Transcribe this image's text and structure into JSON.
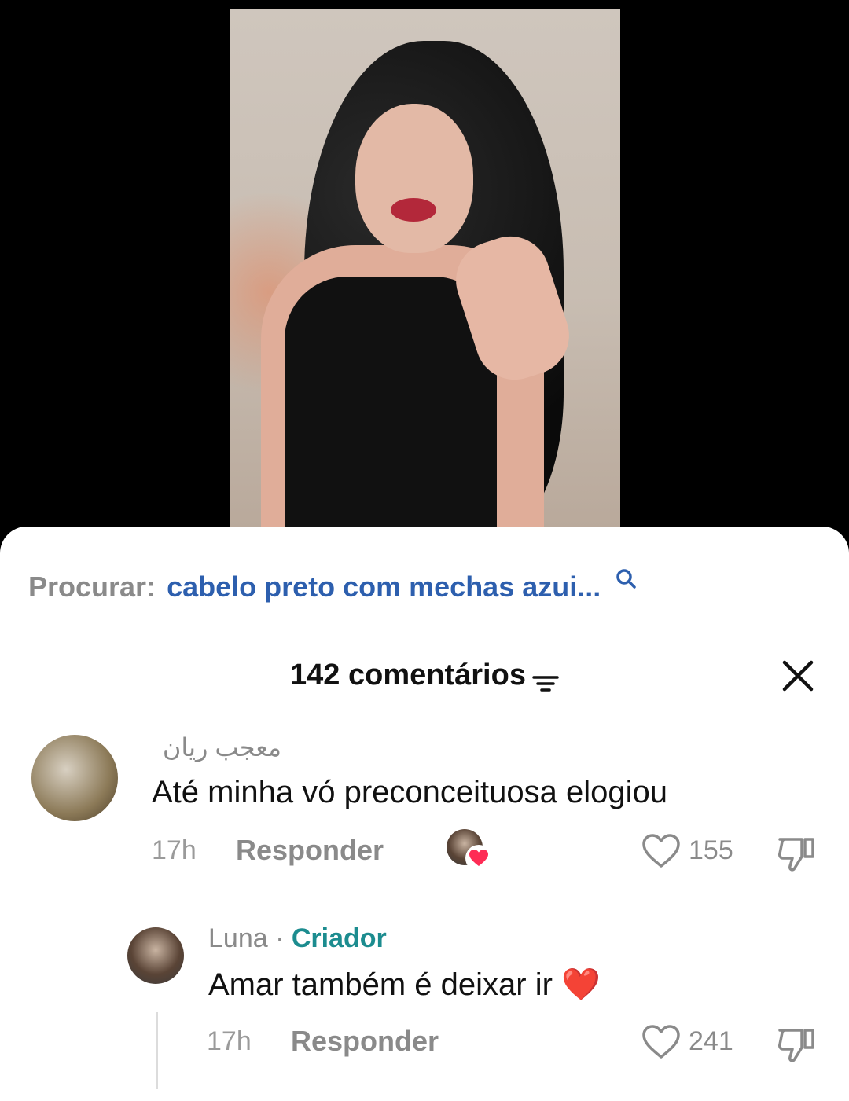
{
  "search": {
    "prefix": "Procurar:",
    "query": "cabelo preto com mechas azui..."
  },
  "header": {
    "count_label": "142 comentários"
  },
  "comments": [
    {
      "username": "معجب ريان",
      "text": "Até minha vó preconceituosa elogiou",
      "time": "17h",
      "reply_label": "Responder",
      "likes": "155"
    },
    {
      "username": "Luna",
      "separator": "·",
      "badge": "Criador",
      "text": "Amar também é deixar ir ❤️",
      "time": "17h",
      "reply_label": "Responder",
      "likes": "241"
    }
  ],
  "colors": {
    "accent_link": "#2d5fae",
    "creator_badge": "#1c8c8f",
    "heart": "#fe2c55"
  }
}
